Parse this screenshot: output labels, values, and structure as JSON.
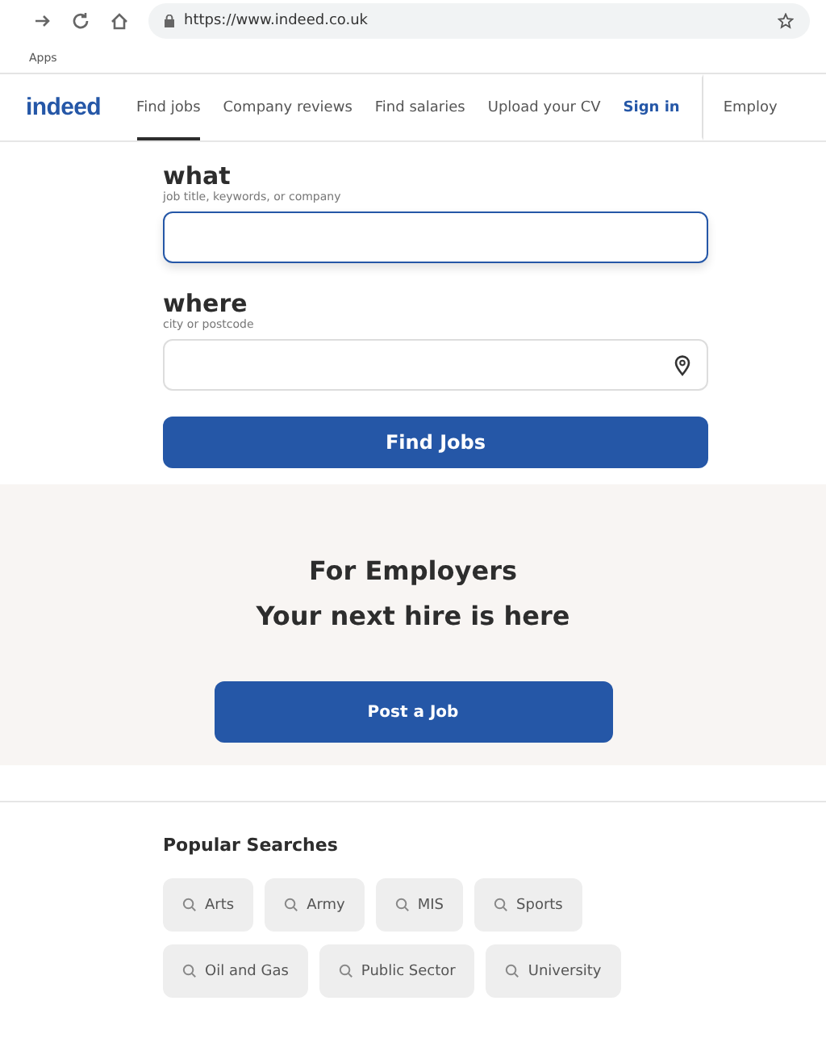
{
  "browser": {
    "url": "https://www.indeed.co.uk",
    "bookmarks": [
      "Apps"
    ]
  },
  "header": {
    "logo": "indeed",
    "nav": [
      {
        "label": "Find jobs",
        "kind": "link",
        "selected": true
      },
      {
        "label": "Company reviews",
        "kind": "link",
        "selected": false
      },
      {
        "label": "Find salaries",
        "kind": "link",
        "selected": false
      },
      {
        "label": "Upload your CV",
        "kind": "link",
        "selected": false
      },
      {
        "label": "Sign in",
        "kind": "signin",
        "selected": false
      },
      {
        "label": "Employ",
        "kind": "link",
        "selected": false
      }
    ]
  },
  "search": {
    "fields": [
      {
        "label": "what",
        "hint": "job title, keywords, or company",
        "focused": true,
        "kind": "text"
      },
      {
        "label": "where",
        "hint": "city or postcode",
        "focused": false,
        "kind": "location"
      }
    ],
    "button": "Find Jobs"
  },
  "employers": {
    "title": "For Employers",
    "subtitle": "Your next hire is here",
    "button": "Post a Job"
  },
  "popular": {
    "title": "Popular Searches",
    "chips": [
      "Arts",
      "Army",
      "MIS",
      "Sports",
      "Oil and Gas",
      "Public Sector",
      "University"
    ]
  }
}
